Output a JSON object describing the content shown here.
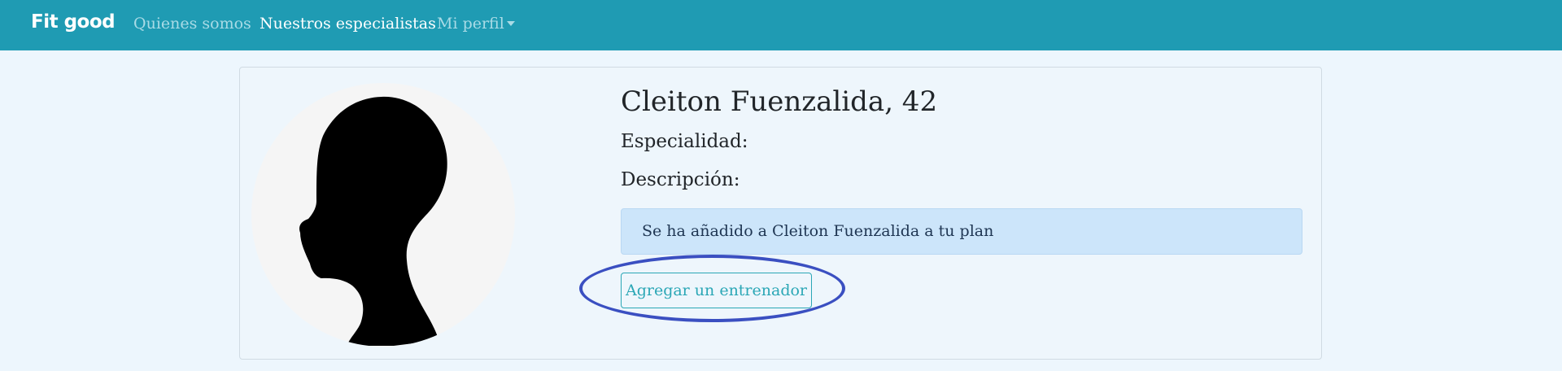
{
  "navbar": {
    "brand": "Fit good",
    "links": [
      {
        "label": "Quienes somos",
        "active": false
      },
      {
        "label": "Nuestros especialistas",
        "active": true
      },
      {
        "label": "Mi perfil",
        "active": false,
        "dropdown": true
      }
    ],
    "background": "#1f9bb3"
  },
  "profile": {
    "name_age": "Cleiton Fuenzalida, 42",
    "specialty_label": "Especialidad:",
    "description_label": "Descripción:",
    "alert_message": "Se ha añadido a Cleiton Fuenzalida a tu plan",
    "add_trainer_button": "Agregar un entrenador",
    "avatar_icon": "person-silhouette-icon"
  },
  "colors": {
    "accent": "#2ba7b6",
    "alert_bg": "#cce5fa",
    "annotation": "#3a4fc1",
    "page_bg": "#edf6fd"
  }
}
